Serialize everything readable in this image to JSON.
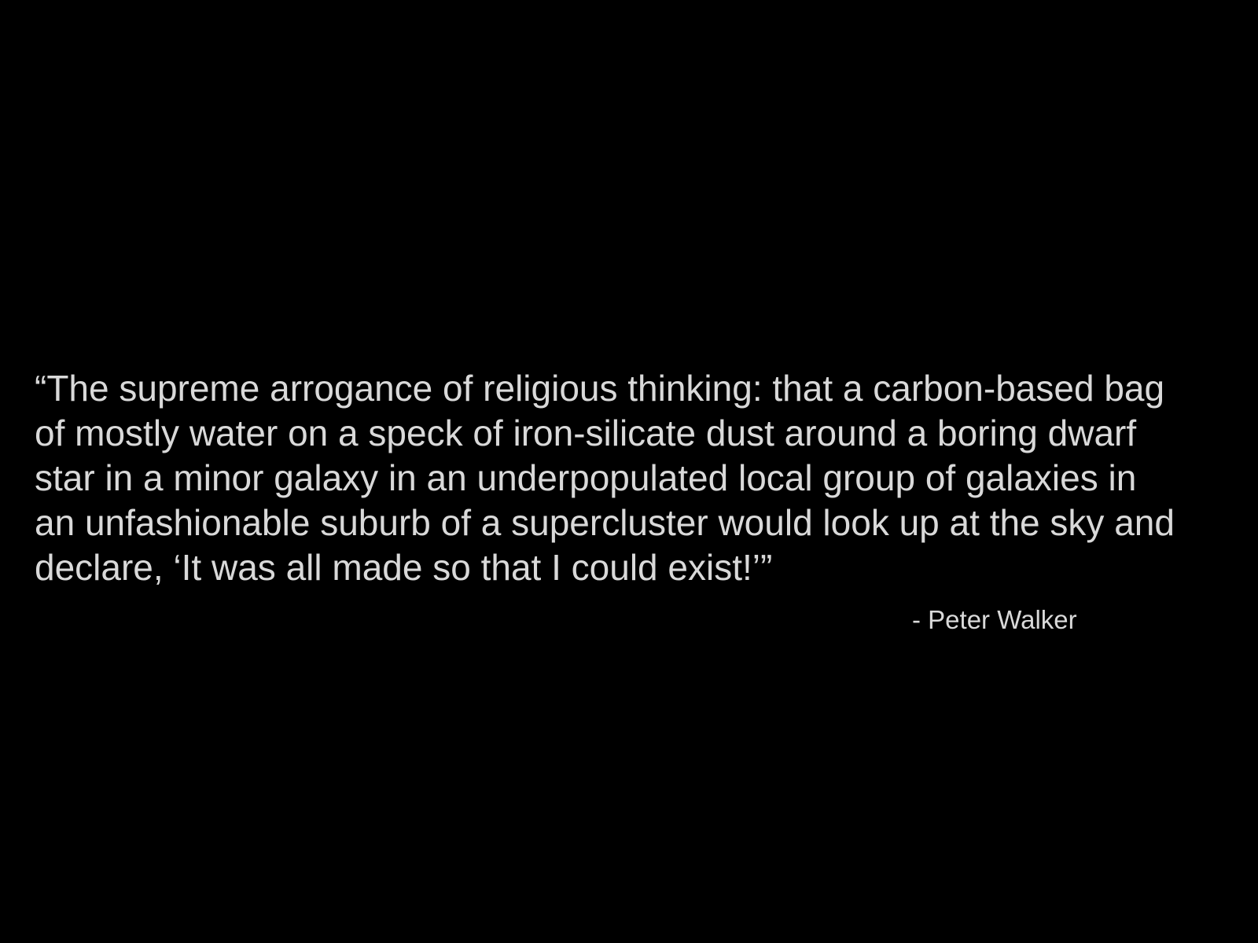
{
  "slide": {
    "background_color": "#000000",
    "text_color": "#d9d9d9",
    "quote_lines": [
      "“The supreme arrogance of religious thinking: that a carbon-based bag",
      "of mostly water on a speck of iron-silicate dust around a boring dwarf",
      "star in a minor galaxy in an underpopulated local group of galaxies in",
      "an unfashionable suburb of a supercluster would look up at the sky and",
      "declare, ‘It was all made so that I could exist!’”"
    ],
    "attribution": "- Peter Walker"
  }
}
